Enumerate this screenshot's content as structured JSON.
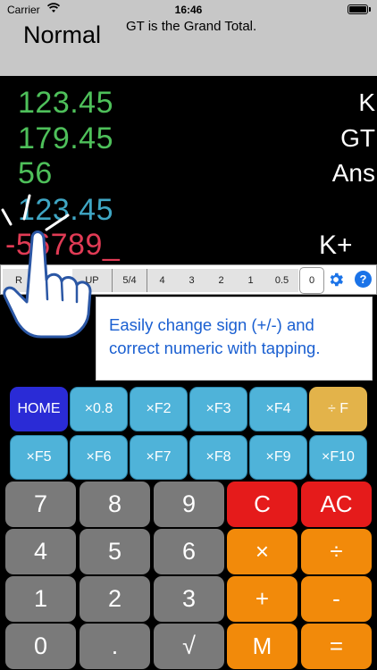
{
  "status": {
    "carrier": "Carrier",
    "time": "16:46"
  },
  "header": {
    "mode": "Normal",
    "note": "GT is the Grand Total."
  },
  "display": {
    "lines": [
      "123.45",
      "179.45",
      "56",
      "123.45",
      "-56789_"
    ],
    "labels": [
      "K",
      "GT",
      "Ans"
    ],
    "mode_label": "K+"
  },
  "round_bar": {
    "segments": [
      "R",
      "UP",
      "5/4",
      "4",
      "3",
      "2",
      "1",
      "0.5",
      "0"
    ],
    "selected": "0",
    "help": "?"
  },
  "tip": {
    "text": "Easily change sign (+/-) and correct numeric with tapping."
  },
  "keys": {
    "func_row1": [
      "HOME",
      "×0.8",
      "×F2",
      "×F3",
      "×F4",
      "÷ F"
    ],
    "func_row2": [
      "×F5",
      "×F6",
      "×F7",
      "×F8",
      "×F9",
      "×F10"
    ],
    "num_rows": [
      [
        "7",
        "8",
        "9",
        "C",
        "AC"
      ],
      [
        "4",
        "5",
        "6",
        "×",
        "÷"
      ],
      [
        "1",
        "2",
        "3",
        "+",
        "-"
      ],
      [
        "0",
        ".",
        "√",
        "M",
        "="
      ]
    ]
  },
  "colors": {
    "green": "#4ec05a",
    "blue": "#3fa6c4",
    "red": "#e13b55",
    "func_key": "#4fb3d9",
    "home_key": "#2a2bd6",
    "div_key": "#e3b34a",
    "num_key": "#7a7a7a",
    "clear_key": "#e51b1b",
    "op_key": "#f28a0a",
    "tip_text": "#1a5fd1"
  }
}
